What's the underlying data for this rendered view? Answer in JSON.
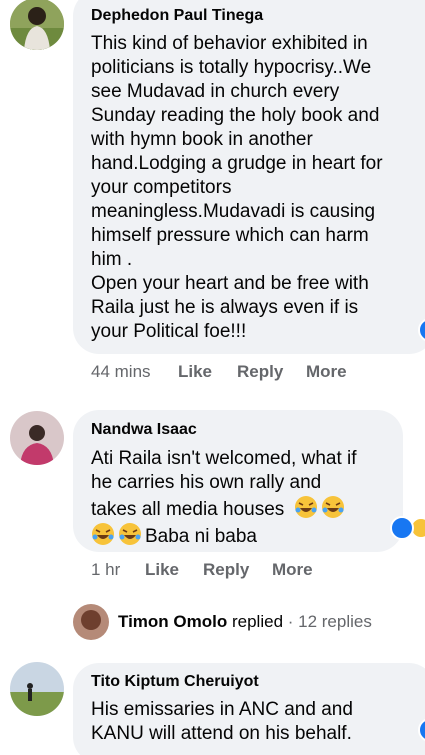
{
  "comments": [
    {
      "author": "Dephedon Paul Tinega",
      "lines": [
        "This kind of behavior exhibited in",
        "politicians is totally hypocrisy..We",
        "see Mudavad in church every",
        "Sunday reading the holy book and",
        "with hymn book in another",
        "hand.Lodging a grudge in heart for",
        "your competitors",
        "meaningless.Mudavadi is causing",
        "himself pressure which can harm",
        "him .",
        "Open your heart and be free with",
        "Raila just he is always even if is",
        "your Political foe!!!"
      ],
      "time": "44 mins",
      "like": "Like",
      "reply": "Reply",
      "more": "More"
    },
    {
      "author": "Nandwa Isaac",
      "lines": [
        "Ati Raila isn't welcomed, what if",
        "he carries his own rally and",
        "takes all media houses"
      ],
      "last_line": "Baba ni baba",
      "time": "1 hr",
      "like": "Like",
      "reply": "Reply",
      "more": "More"
    },
    {
      "author": "Tito Kiptum Cheruiyot",
      "lines": [
        "His emissaries in ANC and and",
        "KANU will attend on his behalf."
      ]
    }
  ],
  "reply_summary": {
    "name": "Timon Omolo",
    "verb": "replied",
    "sep": " · ",
    "count": "12 replies"
  },
  "colors": {
    "bubble": "#f0f2f5",
    "muted": "#65676b",
    "like_blue": "#1877f2"
  },
  "icons": [
    "avatar",
    "like-reaction-icon",
    "haha-reaction-icon",
    "laughing-emoji-icon"
  ]
}
